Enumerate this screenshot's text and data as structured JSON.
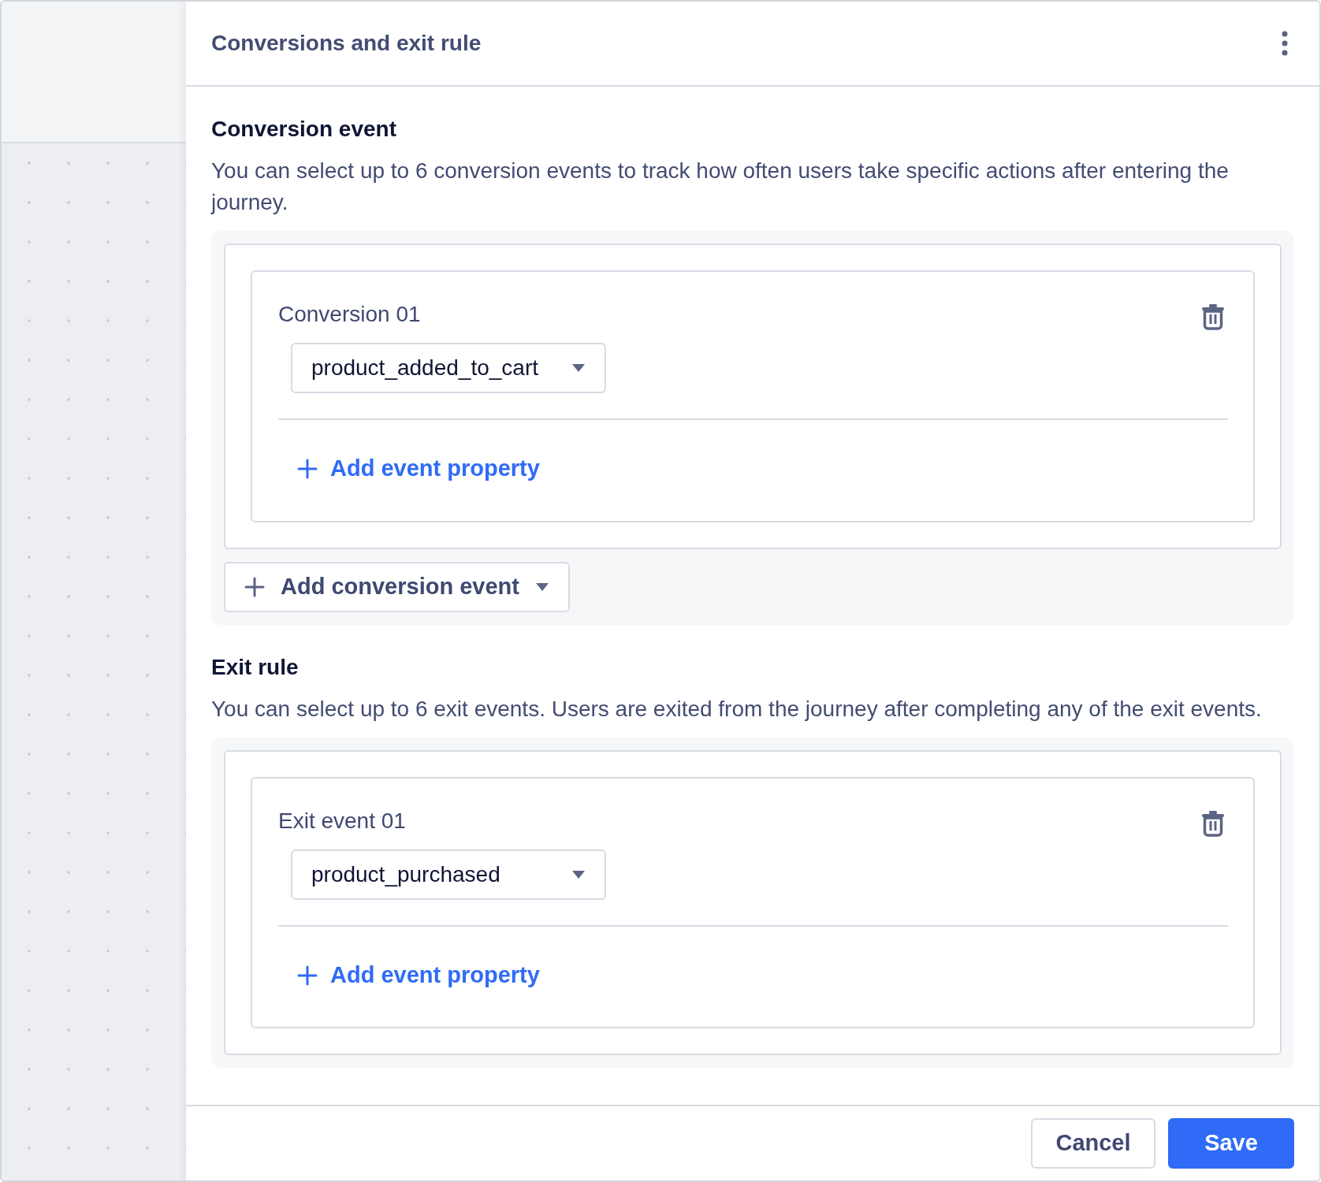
{
  "panel": {
    "title": "Conversions and exit rule"
  },
  "sections": [
    {
      "heading": "Conversion event",
      "description": "You can select up to 6 conversion events to track how often users take specific actions after entering the journey.",
      "items": [
        {
          "label": "Conversion 01",
          "event": "product_added_to_cart",
          "add_property": "Add event property"
        }
      ],
      "add_button": "Add conversion event"
    },
    {
      "heading": "Exit rule",
      "description": "You can select up to 6 exit events. Users are exited from the journey after completing any of the exit events.",
      "items": [
        {
          "label": "Exit event 01",
          "event": "product_purchased",
          "add_property": "Add event property"
        }
      ]
    }
  ],
  "footer": {
    "buttons": [
      {
        "label": "Cancel",
        "kind": "secondary"
      },
      {
        "label": "Save",
        "kind": "primary"
      }
    ]
  }
}
